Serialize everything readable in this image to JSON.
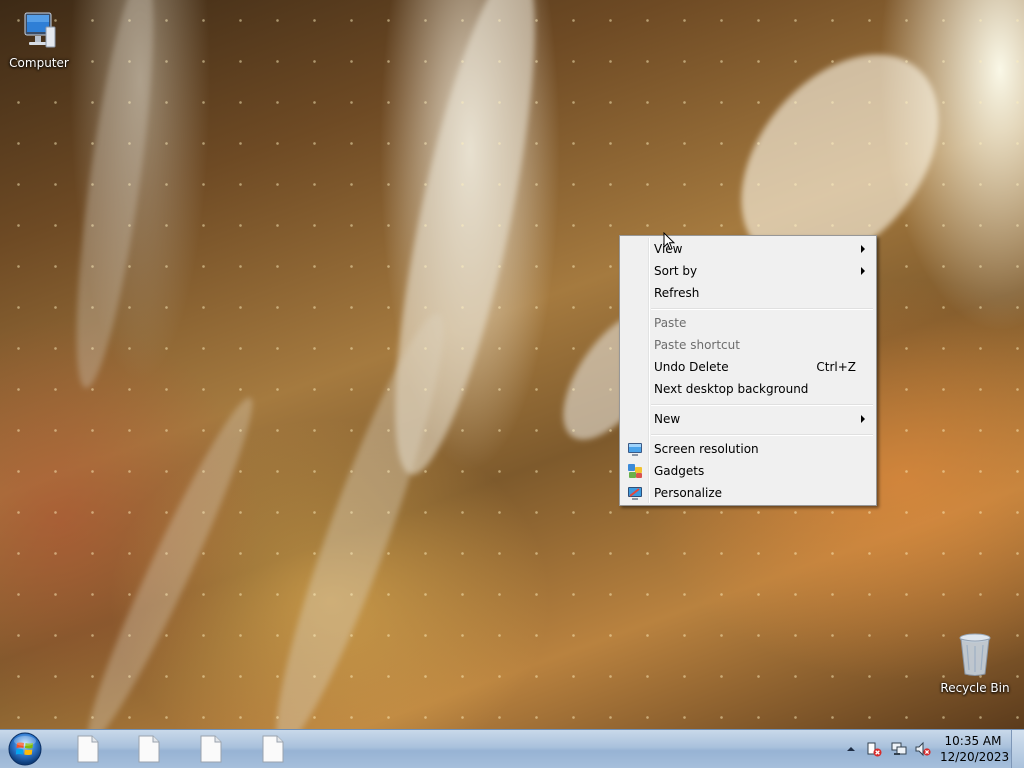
{
  "desktop": {
    "icons": [
      {
        "label": "Computer",
        "icon": "computer-icon"
      },
      {
        "label": "Recycle Bin",
        "icon": "recycle-bin-icon"
      }
    ]
  },
  "context_menu": {
    "items": [
      {
        "label": "View",
        "submenu": true
      },
      {
        "label": "Sort by",
        "submenu": true
      },
      {
        "label": "Refresh"
      },
      {
        "label": "Paste",
        "disabled": true
      },
      {
        "label": "Paste shortcut",
        "disabled": true
      },
      {
        "label": "Undo Delete",
        "shortcut": "Ctrl+Z"
      },
      {
        "label": "Next desktop background"
      },
      {
        "label": "New",
        "submenu": true
      },
      {
        "label": "Screen resolution",
        "icon": "screen-resolution-icon"
      },
      {
        "label": "Gadgets",
        "icon": "gadgets-icon"
      },
      {
        "label": "Personalize",
        "icon": "personalize-icon"
      }
    ]
  },
  "taskbar": {
    "start_icon": "windows-orb-icon",
    "tasks": [
      "file-icon",
      "file-icon",
      "file-icon",
      "file-icon"
    ],
    "tray_icons": [
      "show-hidden-icons-icon",
      "action-center-icon",
      "network-icon",
      "volume-muted-icon"
    ],
    "time": "10:35 AM",
    "date": "12/20/2023"
  }
}
